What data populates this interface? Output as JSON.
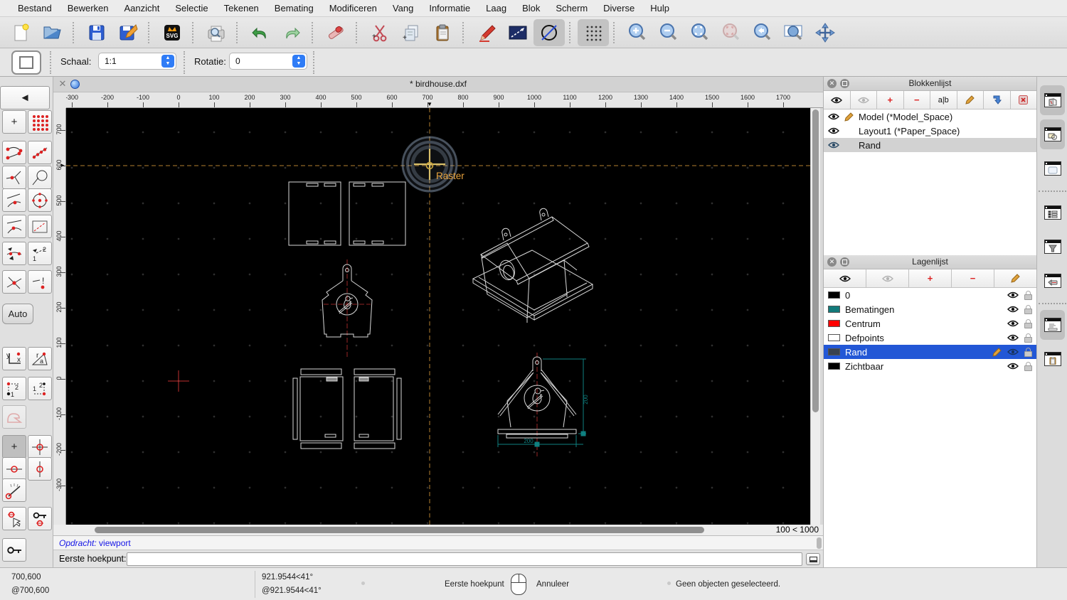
{
  "menu_bar": {
    "items": [
      "Bestand",
      "Bewerken",
      "Aanzicht",
      "Selectie",
      "Tekenen",
      "Bemating",
      "Modificeren",
      "Vang",
      "Informatie",
      "Laag",
      "Blok",
      "Scherm",
      "Diverse",
      "Hulp"
    ]
  },
  "toolbar": {
    "svg_badge": "SVG"
  },
  "options_bar": {
    "scale_label": "Schaal:",
    "scale_value": "1:1",
    "rotation_label": "Rotatie:",
    "rotation_value": "0"
  },
  "snap_palette": {
    "auto_label": "Auto"
  },
  "tab": {
    "title": "* birdhouse.dxf",
    "close_glyph": "✕"
  },
  "rulers": {
    "horizontal": [
      "-300",
      "-200",
      "-100",
      "0",
      "100",
      "200",
      "300",
      "400",
      "500",
      "600",
      "700",
      "800",
      "900",
      "1000",
      "1100",
      "1200",
      "1300",
      "1400",
      "1500",
      "1600",
      "1700"
    ],
    "vertical": [
      "700",
      "600",
      "500",
      "400",
      "300",
      "200",
      "100",
      "0",
      "-100",
      "-200",
      "-300"
    ]
  },
  "canvas": {
    "raster_tooltip": "Raster",
    "grid_status": "100 < 1000",
    "dimension_width": "200",
    "dimension_height": "200"
  },
  "block_panel": {
    "title": "Blokkenlijst",
    "rename_icon_label": "a|b",
    "items": [
      {
        "name": "Model (*Model_Space)"
      },
      {
        "name": "Layout1 (*Paper_Space)"
      },
      {
        "name": "Rand"
      }
    ]
  },
  "layer_panel": {
    "title": "Lagenlijst",
    "items": [
      {
        "name": "0",
        "color": "#000000"
      },
      {
        "name": "Bematingen",
        "color": "#127a7a"
      },
      {
        "name": "Centrum",
        "color": "#ff0000"
      },
      {
        "name": "Defpoints",
        "color": "#ffffff"
      },
      {
        "name": "Rand",
        "color": "#39424e"
      },
      {
        "name": "Zichtbaar",
        "color": "#000000"
      }
    ]
  },
  "command_line": {
    "history_label": "Opdracht:",
    "history_command": "viewport",
    "prompt_label": "Eerste hoekpunt:",
    "input_value": ""
  },
  "status_bar": {
    "coord_abs": "700,600",
    "coord_rel": "@700,600",
    "polar_abs": "921.9544<41°",
    "polar_rel": "@921.9544<41°",
    "mouse_left": "Eerste hoekpunt",
    "mouse_right": "Annuleer",
    "selection_status": "Geen objecten geselecteerd."
  }
}
